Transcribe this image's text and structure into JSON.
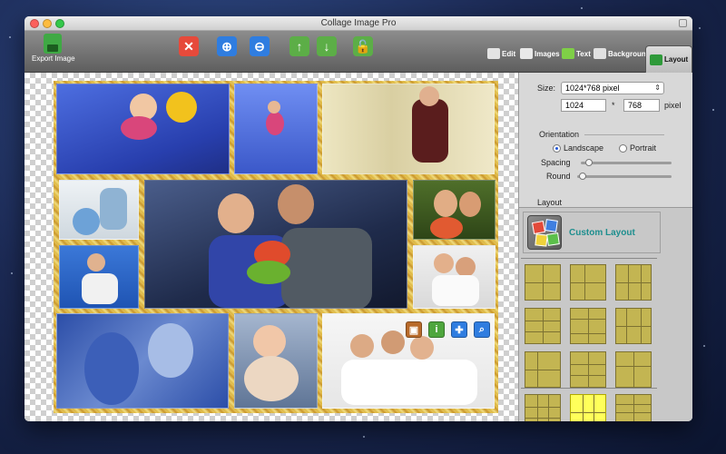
{
  "window": {
    "title": "Collage Image Pro"
  },
  "toolbar": {
    "export_label": "Export Image",
    "actions": [
      {
        "id": "delete",
        "icon": "delete-x-icon",
        "glyph": "✕",
        "color": "#e64a3b"
      },
      {
        "id": "zoom-in",
        "icon": "zoom-in-icon",
        "glyph": "⊕",
        "color": "#2f7de0"
      },
      {
        "id": "zoom-out",
        "icon": "zoom-out-icon",
        "glyph": "⊖",
        "color": "#2f7de0"
      },
      {
        "id": "move-up",
        "icon": "arrow-up-icon",
        "glyph": "↑",
        "color": "#5cae47"
      },
      {
        "id": "move-down",
        "icon": "arrow-down-icon",
        "glyph": "↓",
        "color": "#5cae47"
      },
      {
        "id": "unlock",
        "icon": "unlock-icon",
        "glyph": "🔓",
        "color": "#5cae47"
      }
    ],
    "tabs": [
      {
        "id": "edit",
        "label": "Edit",
        "icon": "edit-icon",
        "color": "#e4e4e4"
      },
      {
        "id": "images",
        "label": "Images",
        "icon": "images-icon",
        "color": "#e9e9e9"
      },
      {
        "id": "text",
        "label": "Text",
        "icon": "text-t-icon",
        "color": "#7fcf47"
      },
      {
        "id": "background",
        "label": "Background",
        "icon": "background-icon",
        "color": "#e0e0e0"
      },
      {
        "id": "layout",
        "label": "Layout",
        "icon": "layout-icon",
        "color": "#2f9a3a",
        "active": true
      }
    ]
  },
  "photo_tools": [
    {
      "icon": "picture-icon",
      "glyph": "▣",
      "color": "#b86a2a"
    },
    {
      "icon": "info-icon",
      "glyph": "i",
      "color": "#4ea63d"
    },
    {
      "icon": "move-icon",
      "glyph": "✚",
      "color": "#2f7de0"
    },
    {
      "icon": "search-icon",
      "glyph": "⌕",
      "color": "#2f7de0"
    }
  ],
  "panel": {
    "size_label": "Size:",
    "size_value": "1024*768 pixel",
    "width_value": "1024",
    "times": "*",
    "height_value": "768",
    "unit": "pixel",
    "orientation_label": "Orientation",
    "landscape_label": "Landscape",
    "portrait_label": "Portrait",
    "orientation_selected": "Landscape",
    "spacing_label": "Spacing",
    "round_label": "Round",
    "spacing_value": 0.05,
    "round_value": 0.02,
    "layout_label": "Layout",
    "custom_layout_label": "Custom Layout",
    "selected_preset": 10
  },
  "colors": {
    "accent": "#1d8e8e",
    "thumb": "#c3b552",
    "thumb_selected": "#ffff5a"
  }
}
